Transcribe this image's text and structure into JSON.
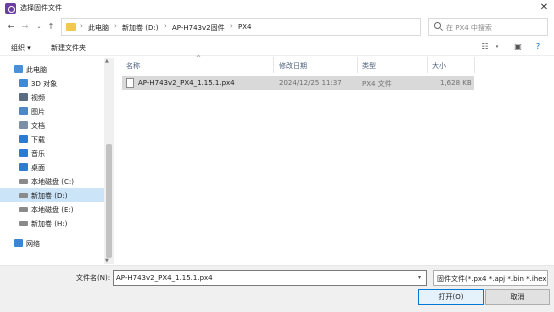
{
  "window": {
    "title": "选择固件文件",
    "close_glyph": "✕"
  },
  "nav_buttons": {
    "back": "←",
    "forward": "→",
    "recent": "⌄",
    "up": "↑"
  },
  "address_bar": {
    "separator": "›",
    "breadcrumbs": [
      "此电脑",
      "新加卷 (D:)",
      "AP-H743v2固件",
      "PX4"
    ]
  },
  "search": {
    "placeholder": "在 PX4 中搜索"
  },
  "toolbar": {
    "organize": "组织 ▾",
    "new_folder": "新建文件夹"
  },
  "sidebar": {
    "items": [
      {
        "label": "此电脑",
        "icon": "computer-icon",
        "color": "#4a90d9"
      },
      {
        "label": "3D 对象",
        "icon": "cube-icon",
        "color": "#3c8ad8"
      },
      {
        "label": "视频",
        "icon": "video-icon",
        "color": "#5b6b82"
      },
      {
        "label": "图片",
        "icon": "pictures-icon",
        "color": "#4d86c9"
      },
      {
        "label": "文档",
        "icon": "documents-icon",
        "color": "#7c8fa6"
      },
      {
        "label": "下载",
        "icon": "download-icon",
        "color": "#2a7bd3"
      },
      {
        "label": "音乐",
        "icon": "music-icon",
        "color": "#2a7bd3"
      },
      {
        "label": "桌面",
        "icon": "desktop-icon",
        "color": "#2d7dcf"
      },
      {
        "label": "本地磁盘 (C:)",
        "icon": "drive-icon",
        "color": "#8a8a8a"
      },
      {
        "label": "新加卷 (D:)",
        "icon": "drive-icon",
        "color": "#8a8a8a",
        "selected": true
      },
      {
        "label": "本地磁盘 (E:)",
        "icon": "drive-icon",
        "color": "#8a8a8a"
      },
      {
        "label": "新加卷 (H:)",
        "icon": "drive-icon",
        "color": "#8a8a8a"
      },
      {
        "label": "网络",
        "icon": "network-icon",
        "color": "#3a86d6"
      }
    ]
  },
  "columns": {
    "name": "名称",
    "date": "修改日期",
    "type": "类型",
    "size": "大小"
  },
  "files": [
    {
      "name": "AP-H743v2_PX4_1.15.1.px4",
      "date": "2024/12/25 11:37",
      "type": "PX4 文件",
      "size": "1,628 KB"
    }
  ],
  "footer": {
    "filename_label": "文件名(N):",
    "filename_value": "AP-H743v2_PX4_1.15.1.px4",
    "filetype_value": "固件文件(*.px4 *.apj *.bin *.ihex)",
    "open_label": "打开(O)",
    "cancel_label": "取消"
  },
  "colors": {
    "selection": "#cce4f7",
    "file_row": "#d9d9d9",
    "accent": "#0078d4",
    "folder": "#f3c64f"
  }
}
